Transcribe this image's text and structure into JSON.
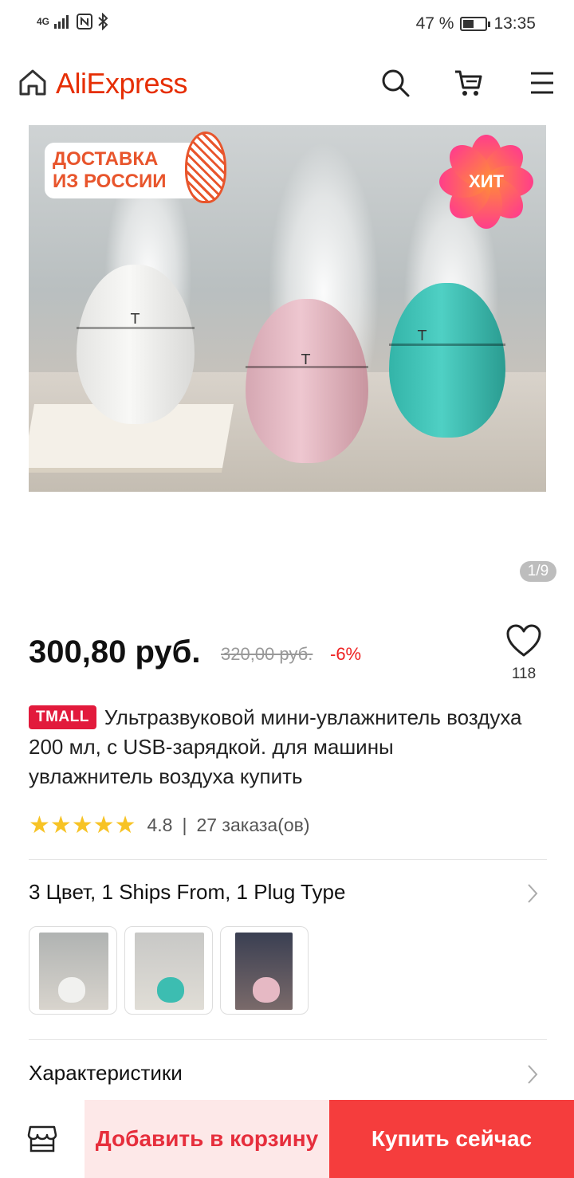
{
  "status_bar": {
    "network": "4G",
    "battery_percent": "47 %",
    "battery_level": 0.47,
    "time": "13:35"
  },
  "header": {
    "logo": "AliExpress",
    "icons": [
      "home-icon",
      "search-icon",
      "cart-icon",
      "menu-icon"
    ]
  },
  "gallery": {
    "promo_line1": "ДОСТАВКА",
    "promo_line2": "ИЗ РОССИИ",
    "hit_badge": "ХИТ",
    "counter": "1/9"
  },
  "product": {
    "price": "300,80 руб.",
    "old_price": "320,00 руб.",
    "discount": "-6%",
    "wishlist_count": "118",
    "store_badge": "TMALL",
    "title": "Ультразвуковой мини-увлажнитель воздуха 200 мл, с USB-зарядкой. для машины увлажнитель воздуха купить",
    "rating_stars": "★★★★★",
    "rating_value": "4.8",
    "rating_separator": "|",
    "orders": "27 заказа(ов)",
    "rating": 4.8
  },
  "options": {
    "label": "3 Цвет, 1 Ships From, 1 Plug Type",
    "variants": [
      "white",
      "teal",
      "pink"
    ]
  },
  "specs": {
    "label": "Характеристики"
  },
  "actions": {
    "add_to_cart": "Добавить в корзину",
    "buy_now": "Купить сейчас"
  },
  "colors": {
    "brand": "#e62e04",
    "buy_now": "#f53d3d",
    "add_cart_bg": "#fde8e8",
    "tmall": "#e21a3c",
    "star": "#f7c325"
  }
}
